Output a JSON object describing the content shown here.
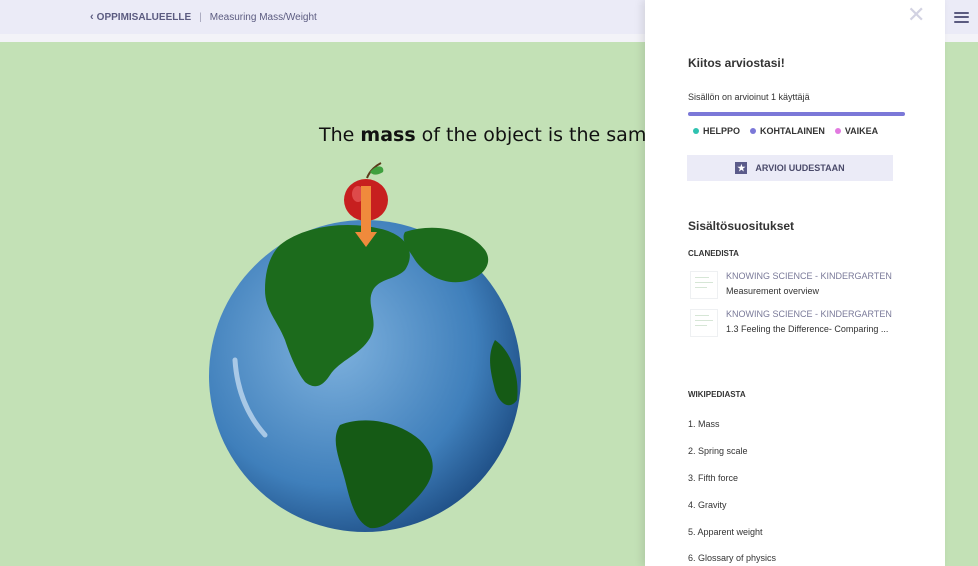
{
  "breadcrumb": {
    "back_label": "OPPIMISALUEELLE",
    "current": "Measuring Mass/Weight"
  },
  "slide": {
    "title_bold": "mass",
    "title_pre": "The ",
    "title_post": " of the object is the same whe"
  },
  "panel": {
    "title": "Kiitos arviostasi!",
    "count_text": "Sisällön on arvioinut 1 käyttäjä",
    "bar_color": "#7b78d8",
    "legend": [
      {
        "label": "HELPPO",
        "color": "#2fc2b0"
      },
      {
        "label": "KOHTALAINEN",
        "color": "#7b78d8"
      },
      {
        "label": "VAIKEA",
        "color": "#e27ae0"
      }
    ],
    "rate_again": "ARVIOI UUDESTAAN",
    "recommend_title": "Sisältösuositukset",
    "clanedista": {
      "heading": "CLANEDISTA",
      "items": [
        {
          "category": "KNOWING SCIENCE - KINDERGARTEN",
          "title": "Measurement overview"
        },
        {
          "category": "KNOWING SCIENCE - KINDERGARTEN",
          "title": "1.3 Feeling the Difference- Comparing ..."
        }
      ]
    },
    "wikipedia": {
      "heading": "WIKIPEDIASTA",
      "items": [
        "1. Mass",
        "2. Spring scale",
        "3. Fifth force",
        "4. Gravity",
        "5. Apparent weight",
        "6. Glossary of physics"
      ]
    }
  }
}
